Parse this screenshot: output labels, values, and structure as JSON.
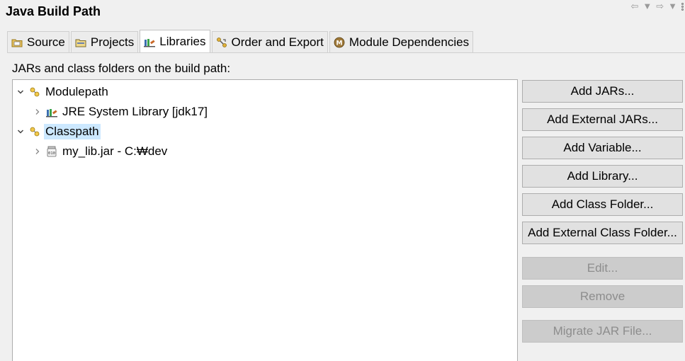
{
  "window": {
    "title": "Java Build Path"
  },
  "tabs": [
    {
      "label": "Source",
      "icon": "source-folder-icon",
      "active": false
    },
    {
      "label": "Projects",
      "icon": "projects-icon",
      "active": false
    },
    {
      "label": "Libraries",
      "icon": "libraries-icon",
      "active": true
    },
    {
      "label": "Order and Export",
      "icon": "order-export-icon",
      "active": false
    },
    {
      "label": "Module Dependencies",
      "icon": "module-icon",
      "active": false
    }
  ],
  "description": "JARs and class folders on the build path:",
  "tree": {
    "nodes": [
      {
        "label": "Modulepath",
        "level": 0,
        "expanded": true,
        "icon": "path-container-icon",
        "selected": false
      },
      {
        "label": "JRE System Library [jdk17]",
        "level": 1,
        "expanded": false,
        "icon": "jre-library-icon",
        "selected": false
      },
      {
        "label": "Classpath",
        "level": 0,
        "expanded": true,
        "icon": "path-container-icon",
        "selected": true
      },
      {
        "label": "my_lib.jar - C:₩dev",
        "level": 1,
        "expanded": false,
        "icon": "jar-file-icon",
        "selected": false
      }
    ]
  },
  "buttons": {
    "add_jars": "Add JARs...",
    "add_external_jars": "Add External JARs...",
    "add_variable": "Add Variable...",
    "add_library": "Add Library...",
    "add_class_folder": "Add Class Folder...",
    "add_external_class_folder": "Add External Class Folder...",
    "edit": "Edit...",
    "remove": "Remove",
    "migrate_jar": "Migrate JAR File..."
  },
  "colors": {
    "selection": "#cce8ff",
    "button_bg": "#e1e1e1",
    "disabled_text": "#8d8d8d"
  }
}
